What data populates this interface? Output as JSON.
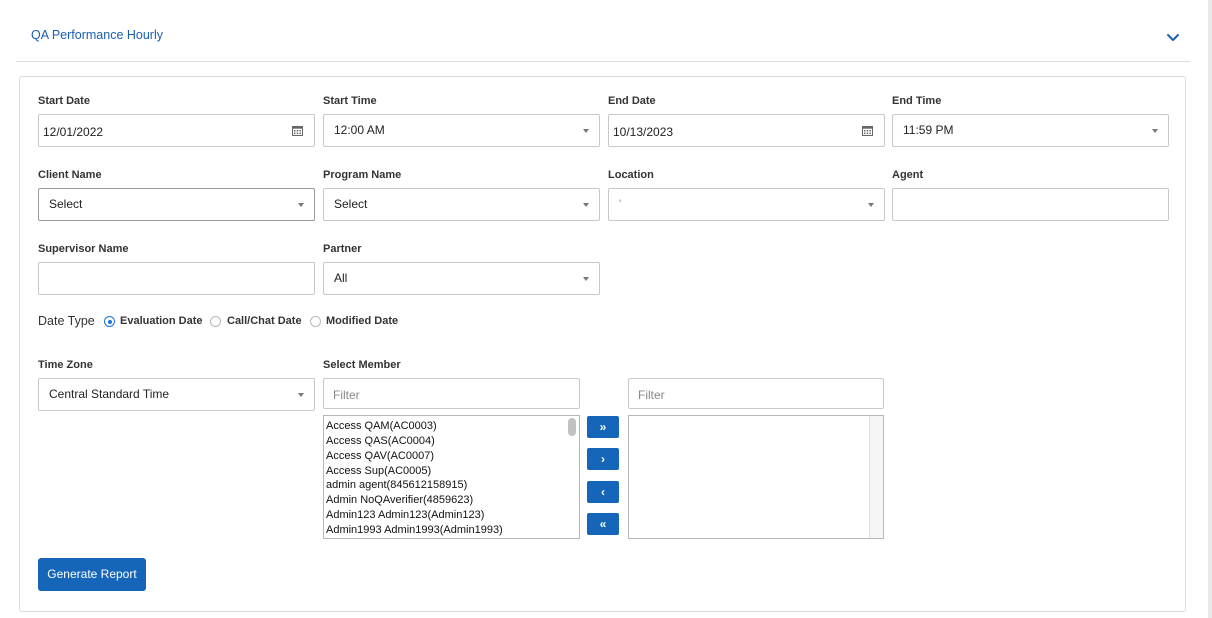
{
  "panel": {
    "title": "QA Performance Hourly"
  },
  "form": {
    "start_date": {
      "label": "Start Date",
      "value": "12/01/2022"
    },
    "start_time": {
      "label": "Start Time",
      "value": "12:00 AM"
    },
    "end_date": {
      "label": "End Date",
      "value": "10/13/2023"
    },
    "end_time": {
      "label": "End Time",
      "value": "11:59 PM"
    },
    "client_name": {
      "label": "Client Name",
      "value": "Select"
    },
    "program_name": {
      "label": "Program Name",
      "value": "Select"
    },
    "location": {
      "label": "Location",
      "value": "'"
    },
    "agent": {
      "label": "Agent",
      "value": ""
    },
    "supervisor_name": {
      "label": "Supervisor Name",
      "value": ""
    },
    "partner": {
      "label": "Partner",
      "value": "All"
    },
    "date_type": {
      "label": "Date Type",
      "options": [
        "Evaluation Date",
        "Call/Chat Date",
        "Modified Date"
      ],
      "selected": "Evaluation Date"
    },
    "time_zone": {
      "label": "Time Zone",
      "value": "Central Standard Time"
    },
    "select_member": {
      "label": "Select Member",
      "left_filter_placeholder": "Filter",
      "right_filter_placeholder": "Filter",
      "available": [
        "Access QAM(AC0003)",
        "Access QAS(AC0004)",
        "Access QAV(AC0007)",
        "Access Sup(AC0005)",
        "admin agent(845612158915)",
        "Admin NoQAverifier(4859623)",
        "Admin123 Admin123(Admin123)",
        "Admin1993 Admin1993(Admin1993)"
      ],
      "selected": [],
      "buttons": {
        "move_all_right": "»",
        "move_right": "›",
        "move_left": "‹",
        "move_all_left": "«"
      }
    },
    "generate_label": "Generate Report"
  },
  "colors": {
    "primary": "#1565b8",
    "link": "#1a5fb4",
    "radio": "#1a73e8"
  }
}
